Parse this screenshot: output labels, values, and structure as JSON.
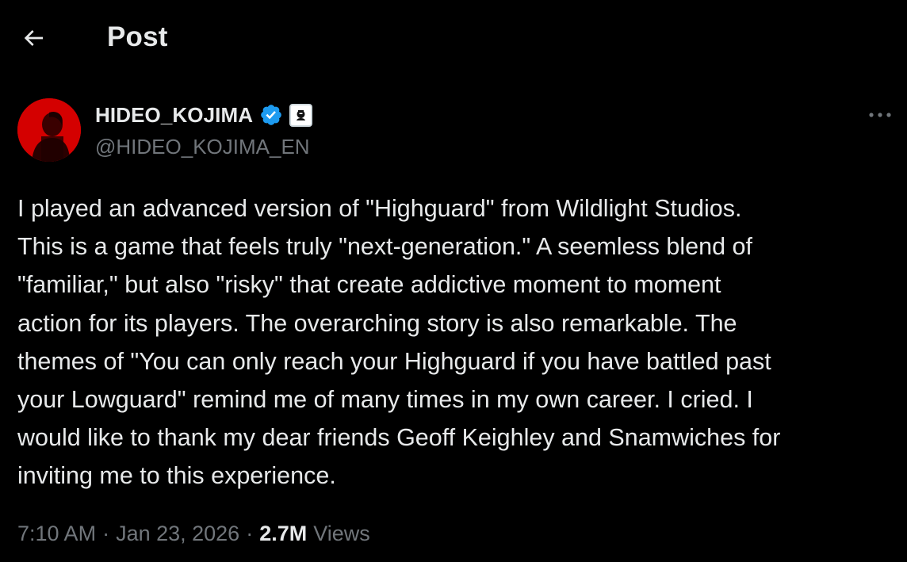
{
  "header": {
    "back_icon": "arrow-left-icon",
    "title": "Post"
  },
  "author": {
    "name": "HIDEO_KOJIMA",
    "handle": "@HIDEO_KOJIMA_EN",
    "verified_icon": "verified-badge-icon",
    "affiliate_icon": "affiliate-badge-icon",
    "avatar_color": "#d40000",
    "verified_color": "#1d9bf0"
  },
  "more_icon": "more-horizontal-icon",
  "post": {
    "lines": [
      "I played an advanced version of \"Highguard\" from Wildlight Studios.",
      "This is a game that feels truly \"next-generation.\" A seemless blend of",
      "\"familiar,\" but also \"risky\" that create addictive moment to moment",
      "action for its players. The overarching story is also remarkable. The",
      "themes of \"You can only reach your Highguard if you have battled past",
      "your Lowguard\" remind me of many times in my own career. I cried. I",
      "would like to thank my dear friends Geoff Keighley and Snamwiches for",
      "inviting me to this experience."
    ]
  },
  "meta": {
    "time": "7:10 AM",
    "separator": "·",
    "date": "Jan 23, 2026",
    "views_count": "2.7M",
    "views_label": "Views"
  },
  "colors": {
    "background": "#000000",
    "text_primary": "#e7e9ea",
    "text_secondary": "#71767b"
  }
}
